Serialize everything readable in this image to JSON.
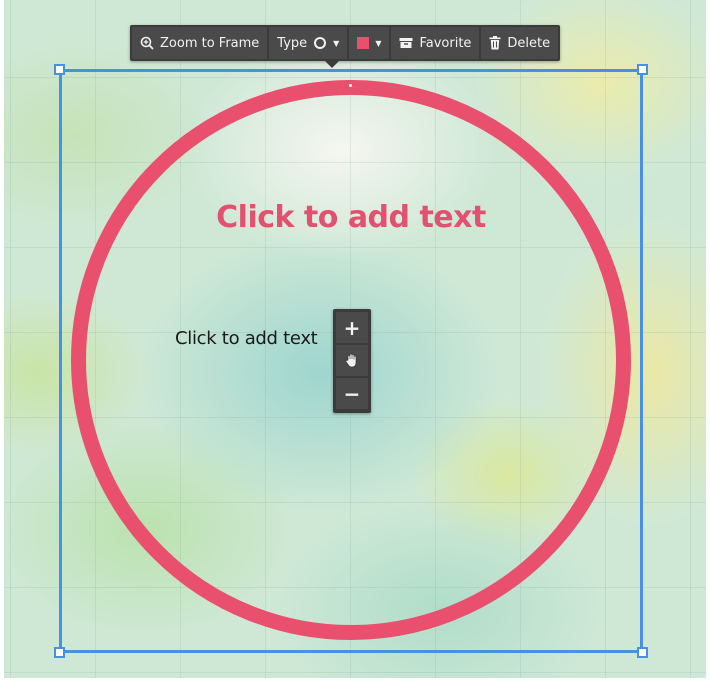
{
  "toolbar": {
    "zoom_to_frame_label": "Zoom to Frame",
    "type_label": "Type",
    "favorite_label": "Favorite",
    "delete_label": "Delete"
  },
  "shape": {
    "type": "circle",
    "color": "#e8506e",
    "frame_color": "#4a90e2",
    "title_text": "Click to add text",
    "body_text": "Click to add text"
  },
  "zoom_controls": {
    "zoom_in_label": "+",
    "zoom_out_label": "−"
  }
}
